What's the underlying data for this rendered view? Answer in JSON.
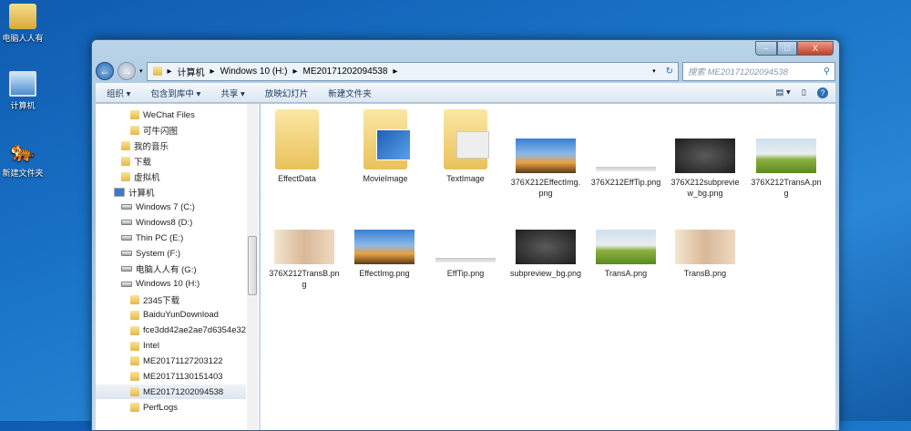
{
  "desktop": [
    {
      "label": "电脑人人有"
    },
    {
      "label": "计算机"
    },
    {
      "label": "新建文件夹"
    }
  ],
  "window": {
    "controls": {
      "minimize": "–",
      "maximize": "□",
      "close": "X"
    }
  },
  "address": {
    "crumbs": [
      "计算机",
      "Windows 10 (H:)",
      "ME20171202094538"
    ],
    "search_placeholder": "搜索 ME20171202094538"
  },
  "toolbar": {
    "organize": "组织 ▾",
    "include": "包含到库中 ▾",
    "share": "共享 ▾",
    "slideshow": "放映幻灯片",
    "new_folder": "新建文件夹"
  },
  "nav": [
    {
      "label": "WeChat Files",
      "type": "folder",
      "indent": 2
    },
    {
      "label": "可牛闪图",
      "type": "folder",
      "indent": 2
    },
    {
      "label": "我的音乐",
      "type": "folder",
      "indent": 1
    },
    {
      "label": "下载",
      "type": "folder",
      "indent": 1
    },
    {
      "label": "虚拟机",
      "type": "folder",
      "indent": 1
    },
    {
      "label": "计算机",
      "type": "computer",
      "indent": 0
    },
    {
      "label": "Windows 7  (C:)",
      "type": "drive",
      "indent": 1
    },
    {
      "label": "Windows8 (D:)",
      "type": "drive",
      "indent": 1
    },
    {
      "label": "Thin PC (E:)",
      "type": "drive",
      "indent": 1
    },
    {
      "label": "System (F:)",
      "type": "drive",
      "indent": 1
    },
    {
      "label": "电脑人人有 (G:)",
      "type": "drive",
      "indent": 1
    },
    {
      "label": "Windows 10 (H:)",
      "type": "drive",
      "indent": 1
    },
    {
      "label": "2345下载",
      "type": "folder",
      "indent": 2
    },
    {
      "label": "BaiduYunDownload",
      "type": "folder",
      "indent": 2
    },
    {
      "label": "fce3dd42ae2ae7d6354e32",
      "type": "folder",
      "indent": 2
    },
    {
      "label": "Intel",
      "type": "folder",
      "indent": 2
    },
    {
      "label": "ME20171127203122",
      "type": "folder",
      "indent": 2
    },
    {
      "label": "ME20171130151403",
      "type": "folder",
      "indent": 2
    },
    {
      "label": "ME20171202094538",
      "type": "folder",
      "indent": 2,
      "selected": true
    },
    {
      "label": "PerfLogs",
      "type": "folder",
      "indent": 2
    }
  ],
  "files": [
    {
      "name": "EffectData",
      "kind": "folder"
    },
    {
      "name": "MovieImage",
      "kind": "folder-win"
    },
    {
      "name": "TextImage",
      "kind": "folder-text"
    },
    {
      "name": "376X212EffectImg.png",
      "kind": "paris"
    },
    {
      "name": "376X212EffTip.png",
      "kind": "bar"
    },
    {
      "name": "376X212subpreview_bg.png",
      "kind": "dark"
    },
    {
      "name": "376X212TransA.png",
      "kind": "field"
    },
    {
      "name": "376X212TransB.png",
      "kind": "girl"
    },
    {
      "name": "EffectImg.png",
      "kind": "paris"
    },
    {
      "name": "EffTip.png",
      "kind": "bar"
    },
    {
      "name": "subpreview_bg.png",
      "kind": "dark"
    },
    {
      "name": "TransA.png",
      "kind": "field"
    },
    {
      "name": "TransB.png",
      "kind": "girl"
    }
  ]
}
